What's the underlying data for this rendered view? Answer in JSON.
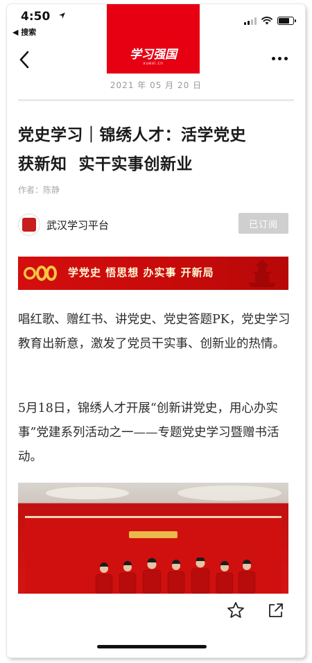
{
  "status_bar": {
    "time": "4:50",
    "back_app_label": "◀ 搜索"
  },
  "header": {
    "logo_brand": "学习强国",
    "logo_site": "xuexi.cn",
    "date": "2021 年 05 月 20 日"
  },
  "article": {
    "title_line1": "党史学习｜锦绣人才：活学党史",
    "title_line2": "获新知  实干实事创新业",
    "author": "作者：陈静",
    "publisher_name": "武汉学习平台",
    "subscribe_label": "已订阅",
    "banner_slogan": "学党史  悟思想  办实事  开新局",
    "paragraph1": "唱红歌、赠红书、讲党史、党史答题PK，党史学习教育出新意，激发了党员干实事、创新业的热情。",
    "paragraph2": "5月18日，锦绣人才开展“创新讲党史，用心办实事”党建系列活动之一——专题党史学习暨赠书活动。"
  },
  "colors": {
    "brand_red": "#e60012",
    "subscribed_gray": "#cfcfcf",
    "text_dark": "#1a1a1a",
    "meta_gray": "#999999"
  },
  "icons": {
    "back": "chevron-left-icon",
    "more": "more-dots-icon",
    "favorite": "star-icon",
    "share": "share-icon"
  }
}
